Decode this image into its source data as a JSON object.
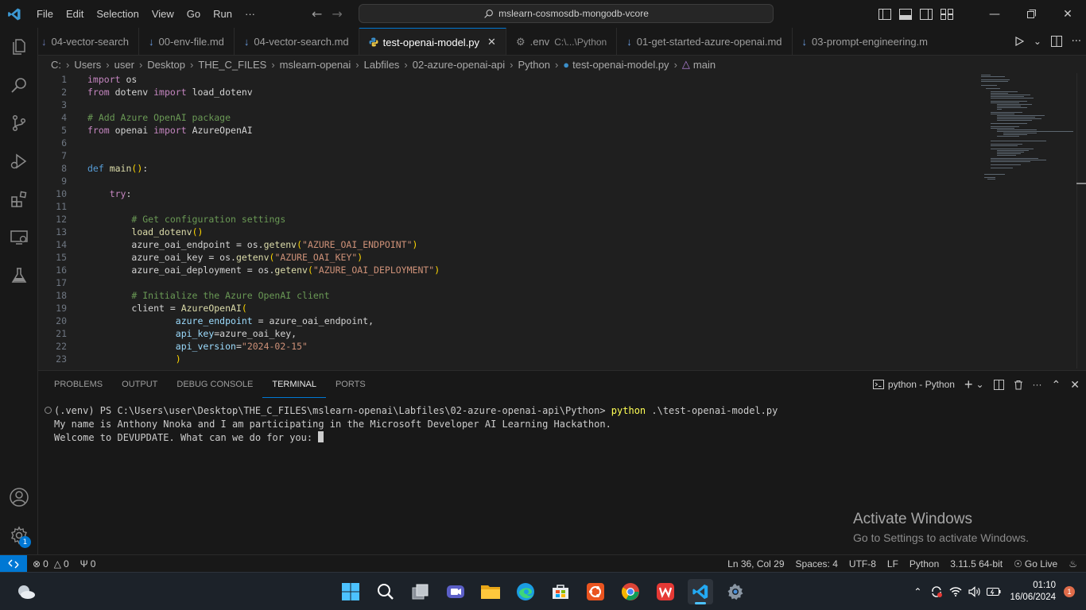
{
  "menu": [
    "File",
    "Edit",
    "Selection",
    "View",
    "Go",
    "Run",
    "···"
  ],
  "search": {
    "text": "mslearn-cosmosdb-mongodb-vcore"
  },
  "tabs": [
    {
      "label": "04-vector-search",
      "desc": ""
    },
    {
      "label": "00-env-file.md",
      "desc": ""
    },
    {
      "label": "04-vector-search.md",
      "desc": ""
    },
    {
      "label": "test-openai-model.py",
      "desc": "",
      "close": "✕"
    },
    {
      "label": ".env",
      "desc": "C:\\...\\Python"
    },
    {
      "label": "01-get-started-azure-openai.md",
      "desc": ""
    },
    {
      "label": "03-prompt-engineering.m",
      "desc": ""
    }
  ],
  "breadcrumb": [
    "C:",
    "Users",
    "user",
    "Desktop",
    "THE_C_FILES",
    "mslearn-openai",
    "Labfiles",
    "02-azure-openai-api",
    "Python",
    "test-openai-model.py",
    "main"
  ],
  "code": {
    "line_numbers": [
      "1",
      "2",
      "3",
      "4",
      "5",
      "6",
      "7",
      "8",
      "9",
      "10",
      "11",
      "12",
      "13",
      "14",
      "15",
      "16",
      "17",
      "18",
      "19",
      "20",
      "21",
      "22",
      "23"
    ],
    "l1": {
      "kw": "import",
      "id": " os"
    },
    "l2": {
      "kw": "from",
      "mod": " dotenv ",
      "kw2": "import",
      "id": " load_dotenv"
    },
    "l4": {
      "cm": "# Add Azure OpenAI package"
    },
    "l5": {
      "kw": "from",
      "mod": " openai ",
      "kw2": "import",
      "id": " AzureOpenAI"
    },
    "l8": {
      "df": "def",
      "fn": " main",
      "br": "()",
      "id": ":"
    },
    "l10": {
      "kw": "try",
      "id": ":"
    },
    "l12": {
      "cm": "# Get configuration settings"
    },
    "l13": {
      "fn": "load_dotenv",
      "br": "()"
    },
    "l14": {
      "id": "azure_oai_endpoint = os.",
      "fn": "getenv",
      "ob": "(",
      "str": "\"AZURE_OAI_ENDPOINT\"",
      "cb": ")"
    },
    "l15": {
      "id": "azure_oai_key = os.",
      "fn": "getenv",
      "ob": "(",
      "str": "\"AZURE_OAI_KEY\"",
      "cb": ")"
    },
    "l16": {
      "id": "azure_oai_deployment = os.",
      "fn": "getenv",
      "ob": "(",
      "str": "\"AZURE_OAI_DEPLOYMENT\"",
      "cb": ")"
    },
    "l18": {
      "cm": "# Initialize the Azure OpenAI client"
    },
    "l19": {
      "id": "client = ",
      "fn": "AzureOpenAI",
      "br": "("
    },
    "l20": {
      "param": "azure_endpoint",
      "id": " = azure_oai_endpoint,"
    },
    "l21": {
      "param": "api_key",
      "id": "=azure_oai_key,"
    },
    "l22": {
      "param": "api_version",
      "id": "=",
      "str": "\"2024-02-15\""
    },
    "l23": {
      "br": ")"
    }
  },
  "panel": {
    "tabs": [
      "PROBLEMS",
      "OUTPUT",
      "DEBUG CONSOLE",
      "TERMINAL",
      "PORTS"
    ],
    "active_tab": "TERMINAL",
    "terminal_name": "python - Python",
    "plus": "+",
    "chevron": "⌄",
    "more": "···"
  },
  "terminal": {
    "prompt": "(.venv) PS C:\\Users\\user\\Desktop\\THE_C_FILES\\mslearn-openai\\Labfiles\\02-azure-openai-api\\Python> ",
    "command": "python",
    "args": " .\\test-openai-model.py",
    "out1": "My name is Anthony Nnoka and I am participating in the Microsoft Developer AI Learning Hackathon.",
    "out2": "Welcome to DEVUPDATE. What can we do for you: "
  },
  "watermark": {
    "line1": "Activate Windows",
    "line2": "Go to Settings to activate Windows."
  },
  "status": {
    "errors": "0",
    "warnings": "0",
    "ports": "0",
    "position": "Ln 36, Col 29",
    "spaces": "Spaces: 4",
    "encoding": "UTF-8",
    "eol": "LF",
    "language": "Python",
    "interpreter": "3.11.5 64-bit",
    "golive": "Go Live"
  },
  "taskbar": {
    "time": "01:10",
    "date": "16/06/2024",
    "notifications": "1"
  },
  "settings_badge": "1",
  "colors": {
    "accent": "#0078d4",
    "editor_bg": "#1f1f1f",
    "chrome_bg": "#181818"
  }
}
